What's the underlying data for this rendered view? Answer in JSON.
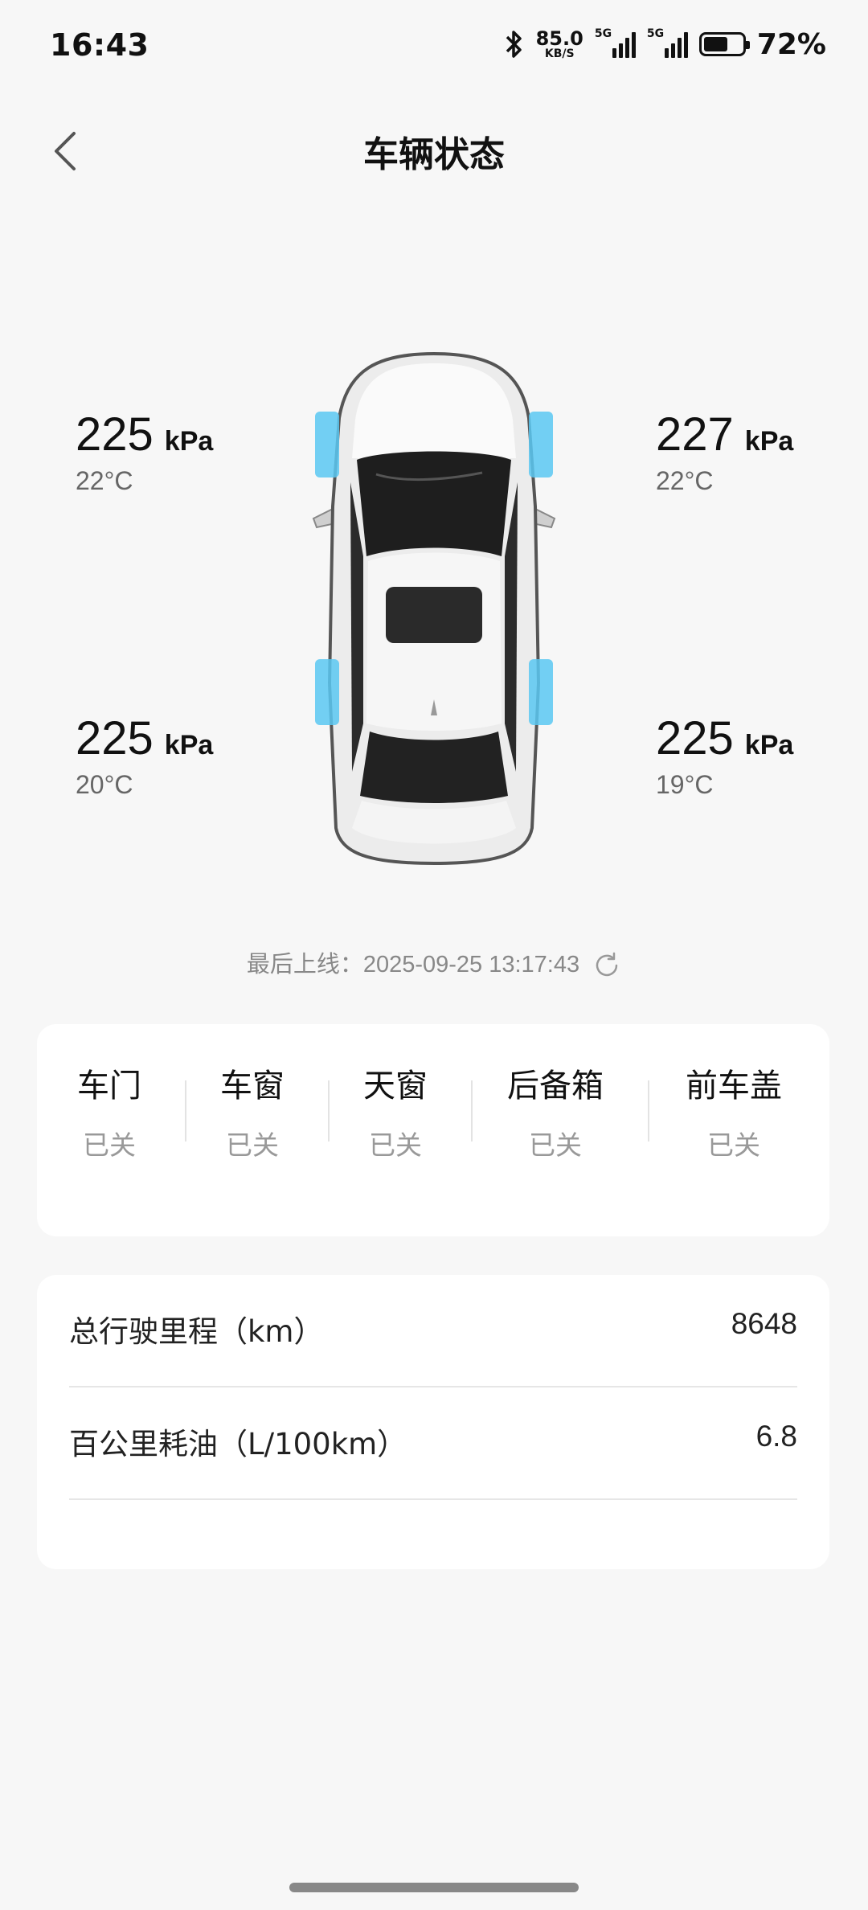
{
  "status_bar": {
    "time": "16:43",
    "net_speed_value": "85.0",
    "net_speed_unit": "KB/S",
    "sim1_tag": "5G",
    "sim2_tag": "5G",
    "battery_percent": "72%",
    "battery_level": 0.72,
    "icons": [
      "bluetooth-icon",
      "signal-icon",
      "battery-icon"
    ]
  },
  "header": {
    "title": "车辆状态",
    "back_icon": "chevron-left-icon"
  },
  "tires": {
    "front_left": {
      "pressure": "225",
      "unit": "kPa",
      "temp": "22°C"
    },
    "front_right": {
      "pressure": "227",
      "unit": "kPa",
      "temp": "22°C"
    },
    "rear_left": {
      "pressure": "225",
      "unit": "kPa",
      "temp": "20°C"
    },
    "rear_right": {
      "pressure": "225",
      "unit": "kPa",
      "temp": "19°C"
    }
  },
  "last_online": {
    "label": "最后上线：2025-09-25 13:17:43",
    "icon": "refresh-icon"
  },
  "vehicle_status": [
    {
      "label": "车门",
      "value": "已关"
    },
    {
      "label": "车窗",
      "value": "已关"
    },
    {
      "label": "天窗",
      "value": "已关"
    },
    {
      "label": "后备箱",
      "value": "已关"
    },
    {
      "label": "前车盖",
      "value": "已关"
    }
  ],
  "stats": [
    {
      "label": "总行驶里程（km）",
      "value": "8648"
    },
    {
      "label": "百公里耗油（L/100km）",
      "value": "6.8"
    }
  ],
  "colors": {
    "background": "#f7f7f7",
    "card": "#ffffff",
    "tire_highlight": "#5bc8f2",
    "secondary_text": "#999999"
  }
}
